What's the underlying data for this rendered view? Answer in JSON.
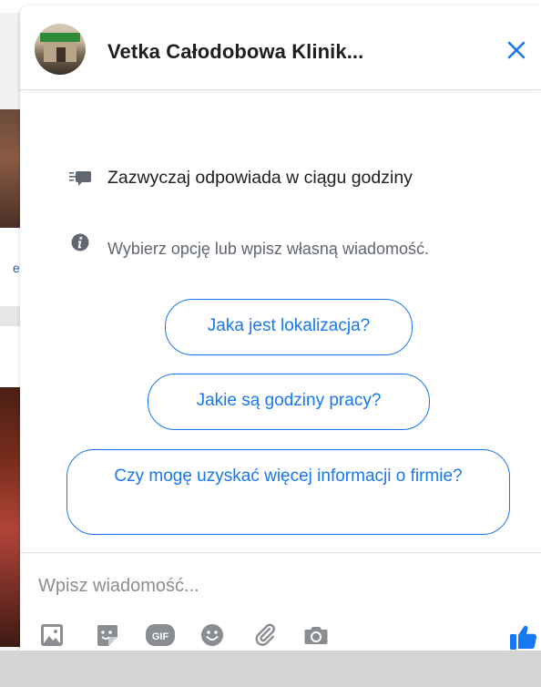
{
  "header": {
    "title": "Vetka Całodobowa Klinik..."
  },
  "info": {
    "response_time": "Zazwyczaj odpowiada w ciągu godziny",
    "hint": "Wybierz opcję lub wpisz własną wiadomość."
  },
  "quick_replies": [
    "Jaka jest lokalizacja?",
    "Jakie są godziny pracy?",
    "Czy mogę uzyskać więcej informacji o firmie?"
  ],
  "composer": {
    "placeholder": "Wpisz wiadomość..."
  },
  "toolbar": {
    "icons": [
      "photo-icon",
      "sticker-icon",
      "gif-icon",
      "emoji-icon",
      "attachment-icon",
      "camera-icon"
    ],
    "gif_label": "GIF",
    "send": "thumbs-up-icon"
  },
  "colors": {
    "accent": "#1877f2",
    "text": "#1c1e21",
    "muted": "#606770",
    "icon_grey": "#8a8d91"
  },
  "left_page": {
    "edge_letter": "e"
  }
}
